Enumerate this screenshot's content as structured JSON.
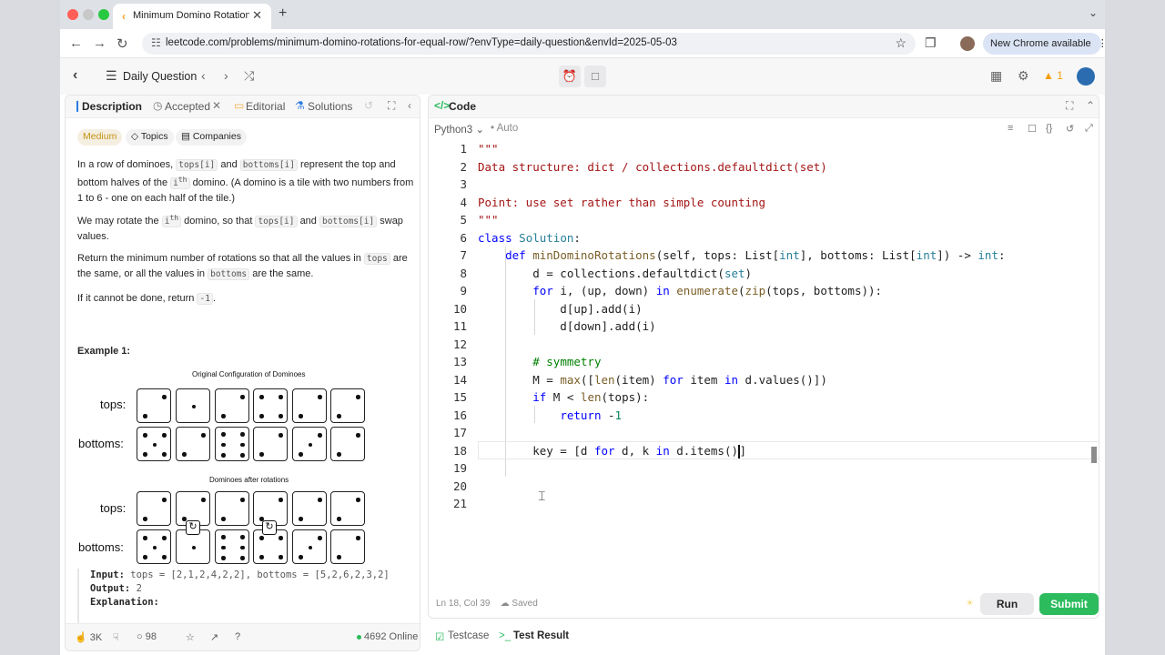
{
  "browser": {
    "tab_title": "Minimum Domino Rotations F",
    "url": "leetcode.com/problems/minimum-domino-rotations-for-equal-row/?envType=daily-question&envId=2025-05-03",
    "chrome_button": "New Chrome available"
  },
  "header": {
    "daily_label": "Daily Question",
    "streak": "1"
  },
  "left_panel": {
    "tabs": {
      "description": "Description",
      "accepted": "Accepted",
      "editorial": "Editorial",
      "solutions": "Solutions"
    },
    "difficulty": "Medium",
    "topics": "Topics",
    "companies": "Companies",
    "paragraphs": {
      "p1_a": "In a row of dominoes,",
      "p1_code1": "tops[i]",
      "p1_b": "and",
      "p1_code2": "bottoms[i]",
      "p1_c": "represent the top and bottom halves of the",
      "p1_i": "i",
      "p1_th": "th",
      "p1_d": "domino. (A domino is a tile with two numbers from 1 to 6 - one on each half of the tile.)",
      "p2_a": "We may rotate the",
      "p2_i": "i",
      "p2_th": "th",
      "p2_b": "domino, so that",
      "p2_code1": "tops[i]",
      "p2_c": "and",
      "p2_code2": "bottoms[i]",
      "p2_d": "swap values.",
      "p3_a": "Return the minimum number of rotations so that all the values in",
      "p3_code1": "tops",
      "p3_b": "are the same, or all the values in",
      "p3_code2": "bottoms",
      "p3_c": "are the same.",
      "p4_a": "If it cannot be done, return",
      "p4_code": "-1",
      "p4_b": "."
    },
    "example_title": "Example 1:",
    "figure": {
      "title1": "Original Configuration of Dominoes",
      "title2": "Dominoes after rotations",
      "tops_label": "tops:",
      "bottoms_label": "bottoms:",
      "original_tops": [
        2,
        1,
        2,
        4,
        2,
        2
      ],
      "original_bottoms": [
        5,
        2,
        6,
        2,
        3,
        2
      ],
      "rotated_tops": [
        2,
        2,
        2,
        2,
        2,
        2
      ],
      "rotated_bottoms": [
        5,
        1,
        6,
        4,
        3,
        2
      ]
    },
    "example": {
      "input_label": "Input:",
      "input_value": "tops = [2,1,2,4,2,2], bottoms = [5,2,6,2,3,2]",
      "output_label": "Output:",
      "output_value": "2",
      "explanation_label": "Explanation:"
    },
    "footer": {
      "likes": "3K",
      "comments": "98",
      "online": "4692 Online"
    }
  },
  "code_panel": {
    "title": "Code",
    "language": "Python3",
    "mode": "Auto",
    "status_position": "Ln 18, Col 39",
    "status_saved": "Saved",
    "run": "Run",
    "submit": "Submit",
    "line_numbers": [
      "1",
      "2",
      "3",
      "4",
      "5",
      "6",
      "7",
      "8",
      "9",
      "10",
      "11",
      "12",
      "13",
      "14",
      "15",
      "16",
      "17",
      "18",
      "19",
      "20",
      "21"
    ]
  },
  "bottom_tabs": {
    "testcase": "Testcase",
    "test_result": "Test Result"
  }
}
